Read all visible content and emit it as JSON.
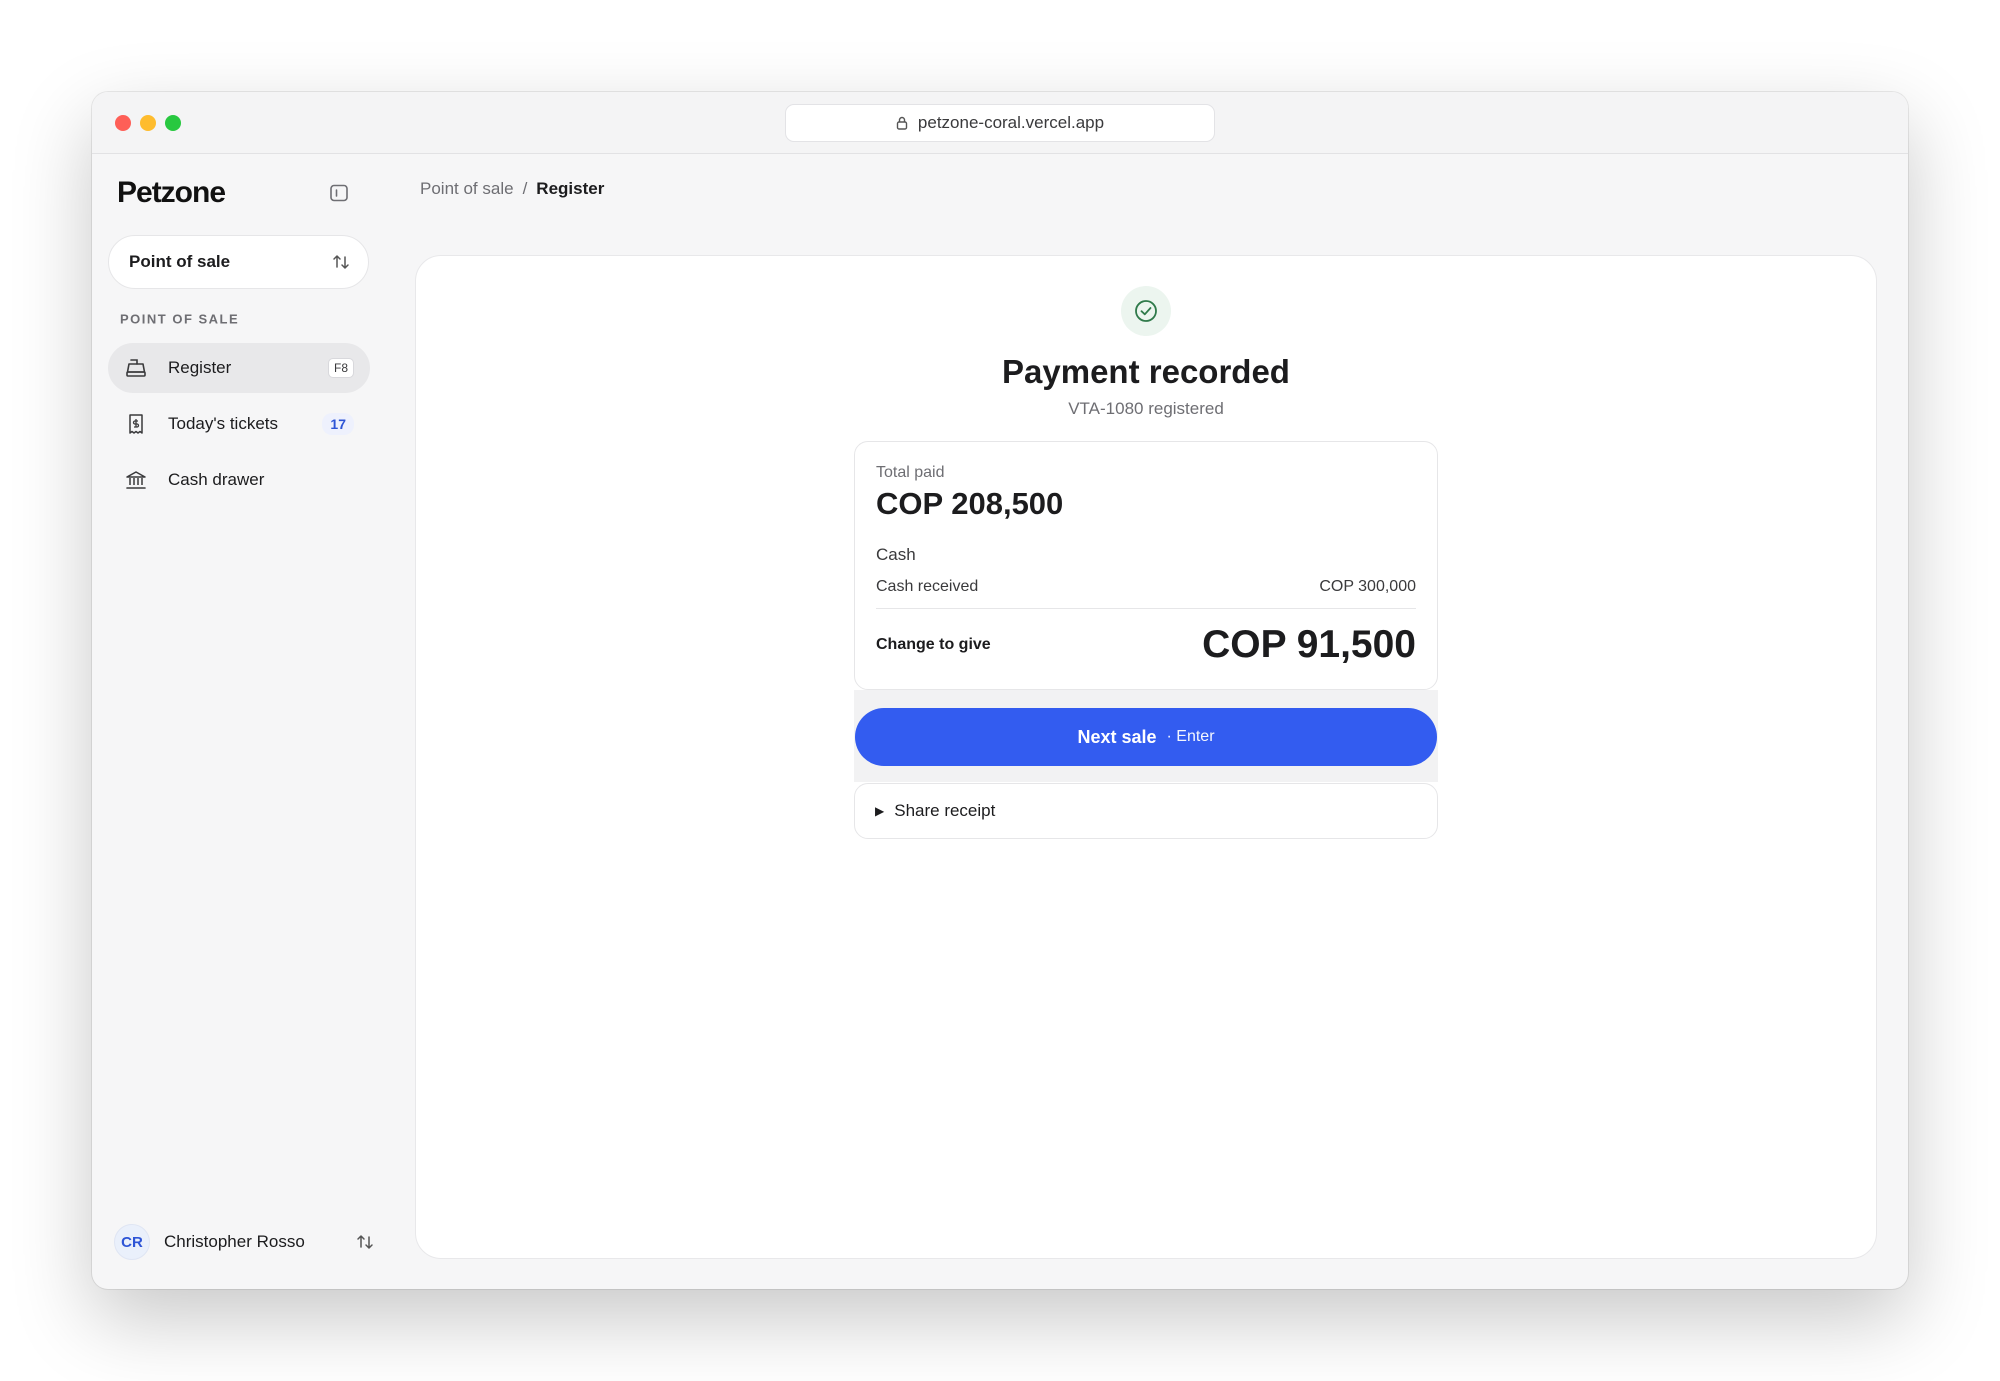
{
  "browser": {
    "url": "petzone-coral.vercel.app"
  },
  "sidebar": {
    "logo": "Petzone",
    "switcher_label": "Point of sale",
    "section_label": "POINT OF SALE",
    "items": [
      {
        "label": "Register",
        "shortcut": "F8",
        "icon": "cash-register-icon",
        "active": true
      },
      {
        "label": "Today's tickets",
        "count": "17",
        "icon": "receipt-icon"
      },
      {
        "label": "Cash drawer",
        "icon": "bank-icon"
      }
    ],
    "user": {
      "initials": "CR",
      "name": "Christopher Rosso"
    }
  },
  "breadcrumb": {
    "parent": "Point of sale",
    "separator": "/",
    "current": "Register"
  },
  "payment": {
    "title": "Payment recorded",
    "subtitle": "VTA-1080 registered",
    "total_label": "Total paid",
    "total_value": "COP 208,500",
    "method": "Cash",
    "received_label": "Cash received",
    "received_value": "COP 300,000",
    "change_label": "Change to give",
    "change_value": "COP 91,500",
    "next_label": "Next sale",
    "next_hint": "· Enter",
    "share_label": "Share receipt"
  },
  "colors": {
    "accent": "#335cf0",
    "success": "#2f7a4a",
    "badge": "#2e55d6"
  }
}
